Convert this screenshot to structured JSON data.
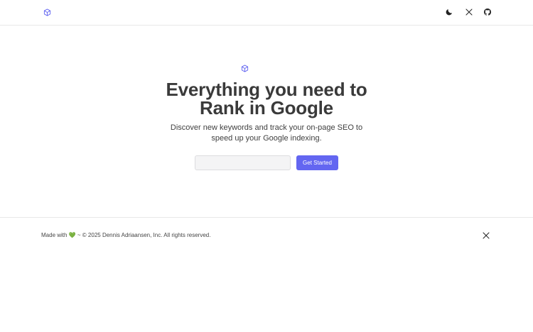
{
  "header": {
    "logo_icon": "box-icon",
    "nav_icons": [
      "moon-icon",
      "x-icon",
      "github-icon"
    ]
  },
  "hero": {
    "icon": "box-icon",
    "title_line1": "Everything you need to",
    "title_line2": "Rank in Google",
    "subtitle_line1": "Discover new keywords and track your on-page SEO to",
    "subtitle_line2": "speed up your Google indexing.",
    "input_value": "",
    "cta_label": "Get Started"
  },
  "footer": {
    "made_with": "Made with",
    "heart": "💚",
    "copyright": "~ © 2025 Dennis Adriaansen, Inc. All rights reserved.",
    "social_icon": "x-icon"
  },
  "colors": {
    "accent": "#6366f1",
    "logo": "#6366f1",
    "text": "#3a3a3a",
    "border": "#e8e8e8"
  }
}
